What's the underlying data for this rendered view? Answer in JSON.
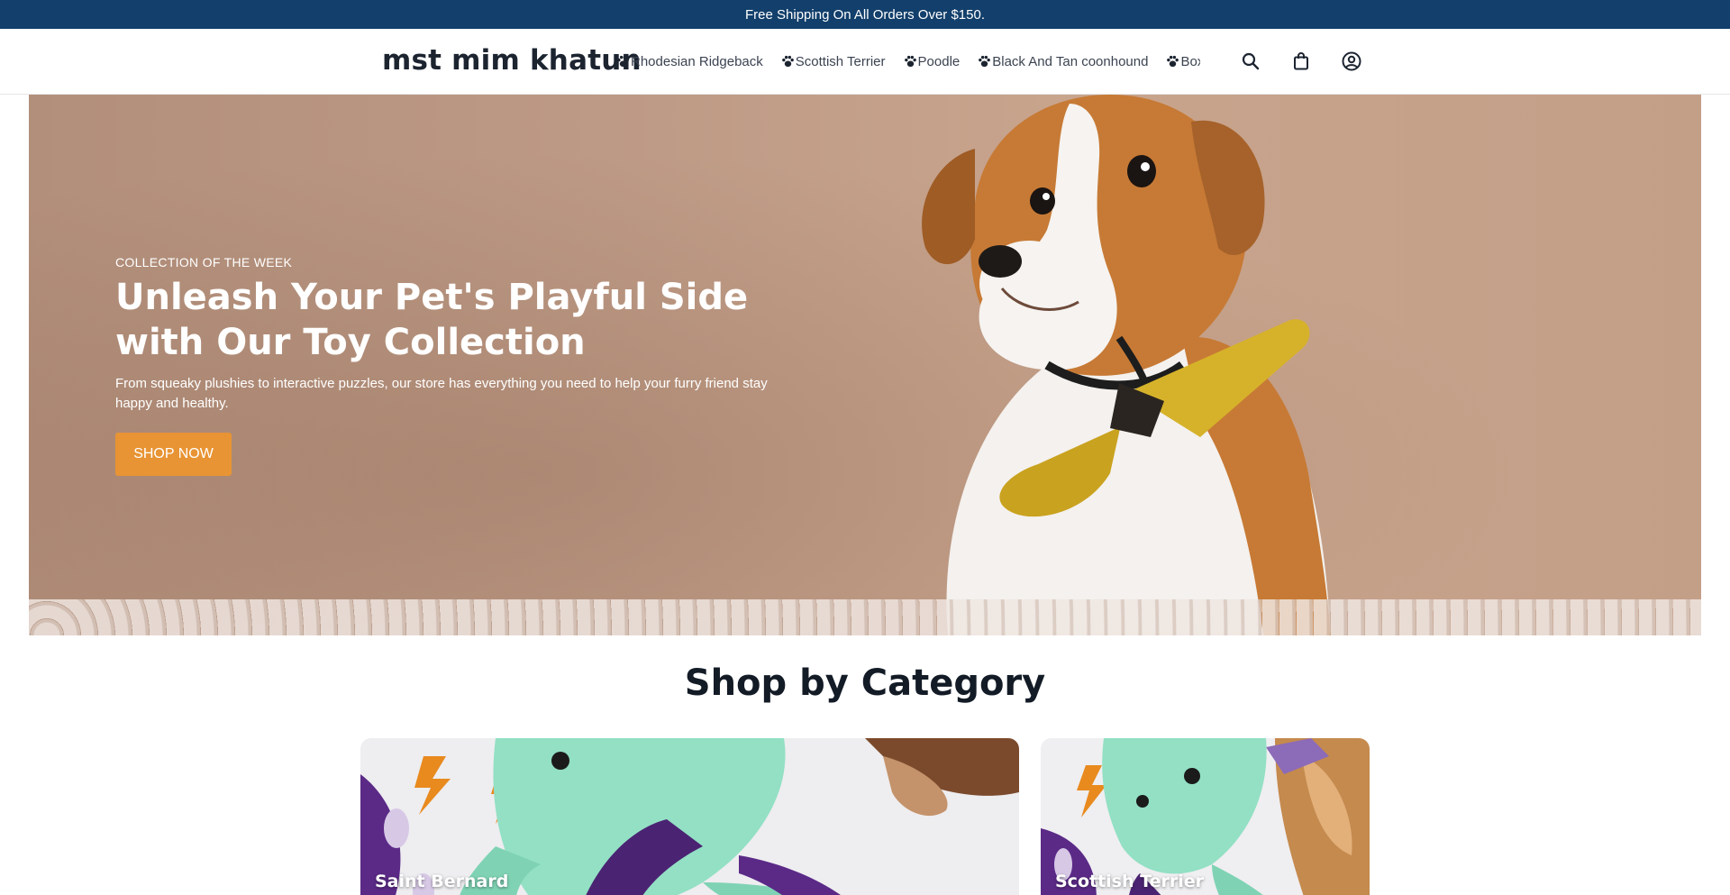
{
  "announcement": {
    "text": "Free Shipping On All Orders Over $150."
  },
  "header": {
    "logo": "mst mim khatun",
    "nav_icon": "paw-icon",
    "nav": [
      {
        "label": "Rhodesian Ridgeback"
      },
      {
        "label": "Scottish Terrier"
      },
      {
        "label": "Poodle"
      },
      {
        "label": "Black And Tan coonhound"
      },
      {
        "label": "Boxer"
      }
    ],
    "icons": [
      "search-icon",
      "shopping-bag-icon",
      "account-icon"
    ]
  },
  "hero": {
    "eyebrow": "COLLECTION OF THE WEEK",
    "title": "Unleash Your Pet's Playful Side with Our Toy Collection",
    "subtitle": "From squeaky plushies to interactive puzzles, our store has everything you need to help your furry friend stay happy and healthy.",
    "cta": "SHOP NOW"
  },
  "categories": {
    "title": "Shop by Category",
    "items": [
      {
        "label": "Saint Bernard"
      },
      {
        "label": "Scottish Terrier"
      }
    ]
  },
  "colors": {
    "announcement_bg": "#123f6b",
    "accent": "#e89434",
    "hero_bg": "#c29d86"
  }
}
